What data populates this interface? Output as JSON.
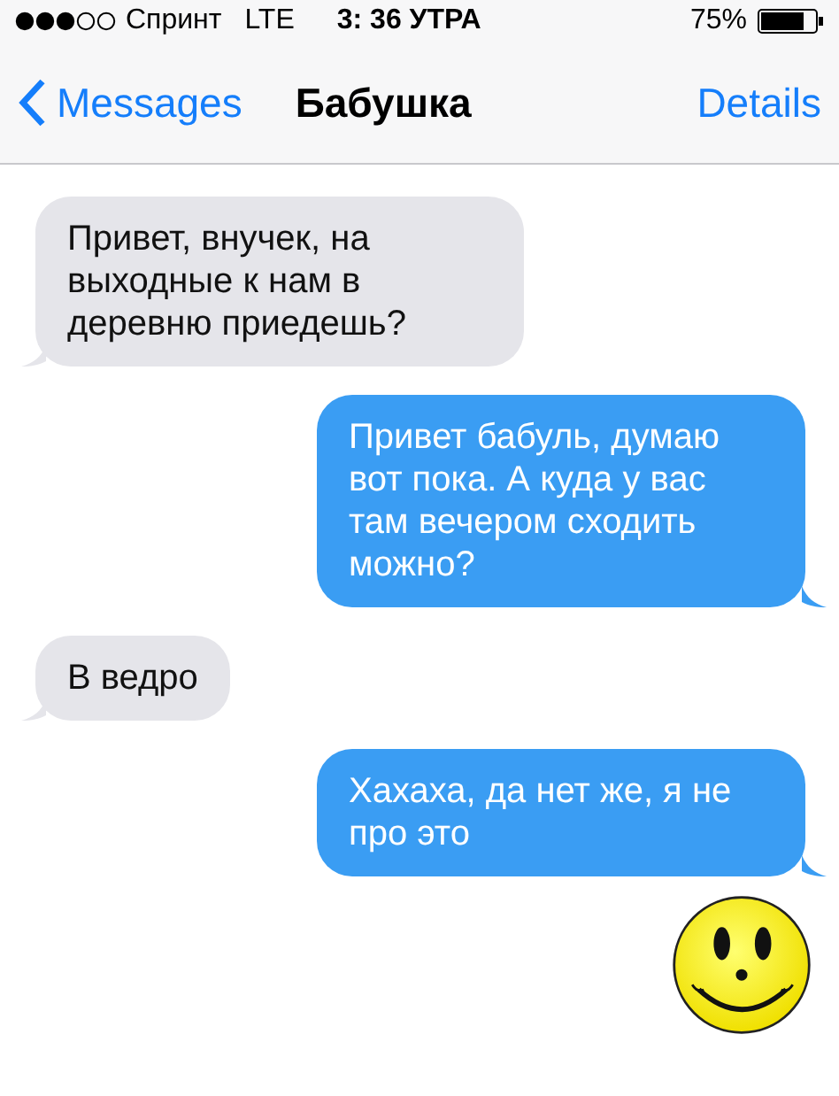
{
  "status_bar": {
    "carrier": "Спринт",
    "network": "LTE",
    "time": "3: 36 УТРА",
    "battery": "75%"
  },
  "nav": {
    "back": "Messages",
    "title": "Бабушка",
    "action": "Details"
  },
  "messages": [
    {
      "kind": "incoming",
      "text": "Привет, внучек, на выходные к нам в деревню приедешь?"
    },
    {
      "kind": "outgoing",
      "text": "Привет бабуль, думаю вот пока. А куда у вас там вечером сходить можно?"
    },
    {
      "kind": "incoming",
      "text": "В ведро"
    },
    {
      "kind": "outgoing",
      "text": "Хахаха, да нет же, я не про это"
    }
  ]
}
